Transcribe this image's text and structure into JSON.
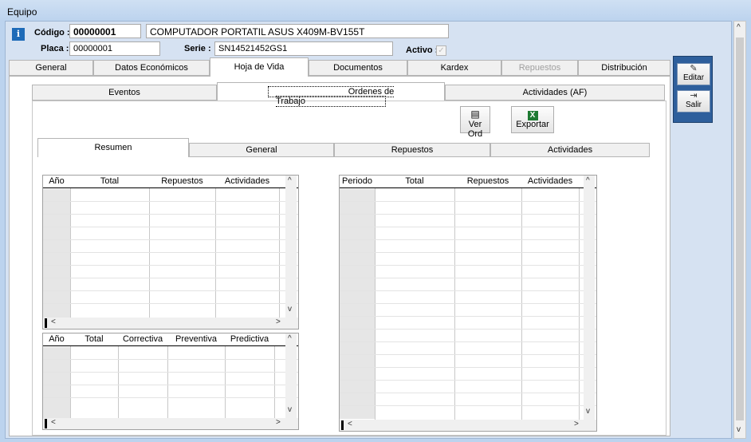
{
  "window": {
    "title": "Equipo"
  },
  "header": {
    "codigo_label": "Código :",
    "codigo_value": "00000001",
    "description": "COMPUTADOR PORTATIL ASUS X409M-BV155T",
    "placa_label": "Placa :",
    "placa_value": "00000001",
    "serie_label": "Serie :",
    "serie_value": "SN14521452GS1",
    "activo_label": "Activo :",
    "activo_checked": true
  },
  "main_tabs": [
    "General",
    "Datos Económicos",
    "Hoja de Vida",
    "Documentos",
    "Kardex",
    "Repuestos",
    "Distribución"
  ],
  "sub_tabs": [
    "Eventos",
    "Ordenes de Trabajo",
    "Actividades (AF)"
  ],
  "toolbar": {
    "ver_ord": "Ver Ord",
    "exportar": "Exportar"
  },
  "inner_tabs": [
    "Resumen",
    "General",
    "Repuestos",
    "Actividades"
  ],
  "grid_year": {
    "columns": [
      "Año",
      "Total",
      "Repuestos",
      "Actividades"
    ]
  },
  "grid_type": {
    "columns": [
      "Año",
      "Total",
      "Correctiva",
      "Preventiva",
      "Predictiva"
    ]
  },
  "grid_period": {
    "columns": [
      "Periodo",
      "Total",
      "Repuestos",
      "Actividades"
    ]
  },
  "side_actions": {
    "editar": "Editar",
    "salir": "Salir"
  },
  "glyphs": {
    "info": "i",
    "scroll_up": "^",
    "scroll_down": "v",
    "scroll_left": "<",
    "scroll_right": ">",
    "check": "✓"
  },
  "colors": {
    "accent": "#2e5f9c",
    "background": "#bcd3ee"
  }
}
